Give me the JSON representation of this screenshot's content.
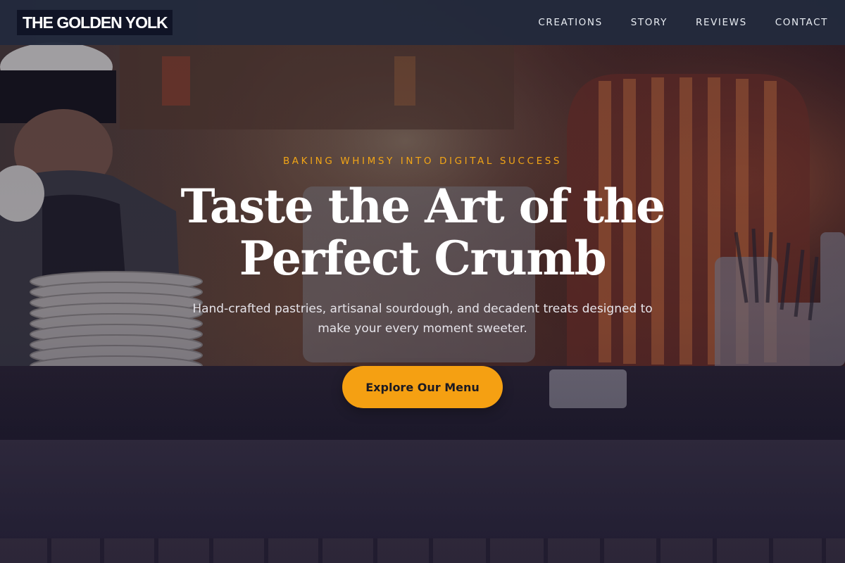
{
  "header": {
    "logo": "THE GOLDEN YOLK",
    "nav": [
      {
        "label": "CREATIONS"
      },
      {
        "label": "STORY"
      },
      {
        "label": "REVIEWS"
      },
      {
        "label": "CONTACT"
      }
    ]
  },
  "hero": {
    "eyebrow": "BAKING WHIMSY INTO DIGITAL SUCCESS",
    "headline_line1": "Taste the Art of the",
    "headline_line2": "Perfect Crumb",
    "subtitle": "Hand-crafted pastries, artisanal sourdough, and decadent treats designed to make your every moment sweeter.",
    "cta_label": "Explore Our Menu"
  },
  "colors": {
    "accent": "#f5a012",
    "header_bg": "#222a3c",
    "logo_bg": "#101426"
  }
}
